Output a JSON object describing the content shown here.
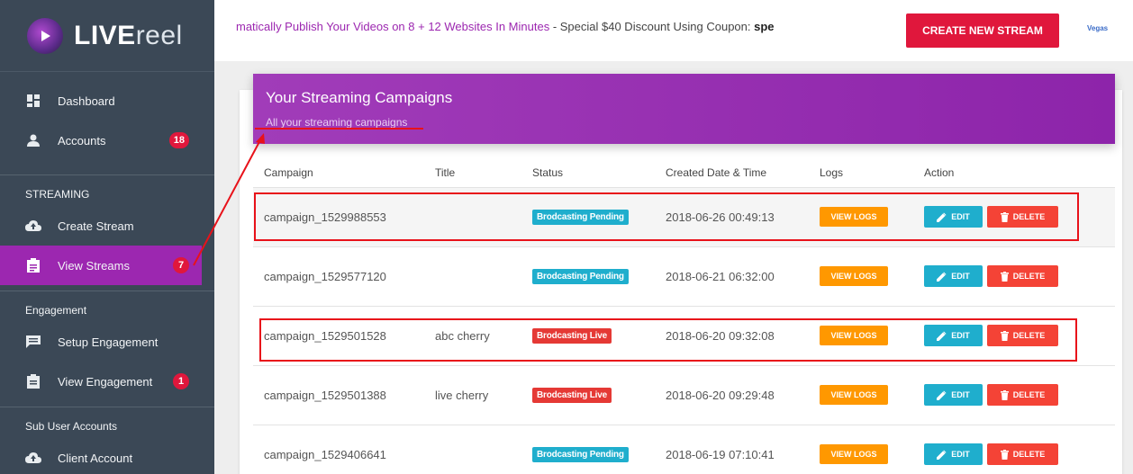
{
  "logo": {
    "bold": "LIVE",
    "light": "reel"
  },
  "sidebar": {
    "items": [
      {
        "label": "Dashboard"
      },
      {
        "label": "Accounts",
        "badge": "18"
      }
    ],
    "sections": [
      {
        "title": "STREAMING",
        "items": [
          {
            "label": "Create Stream"
          },
          {
            "label": "View Streams",
            "badge": "7"
          }
        ]
      },
      {
        "title": "Engagement",
        "items": [
          {
            "label": "Setup Engagement"
          },
          {
            "label": "View Engagement",
            "badge": "1"
          }
        ]
      },
      {
        "title": "Sub User Accounts",
        "items": [
          {
            "label": "Client Account"
          }
        ]
      }
    ]
  },
  "topbar": {
    "marquee_link": "matically Publish Your Videos on 8 + 12 Websites In Minutes",
    "marquee_text": " - Special $40 Discount Using Coupon: ",
    "coupon": "spe",
    "create_label": "CREATE NEW STREAM",
    "partner": "Vegas"
  },
  "card": {
    "title": "Your Streaming Campaigns",
    "subtitle": "All your streaming campaigns"
  },
  "table": {
    "headers": [
      "Campaign",
      "Title",
      "Status",
      "Created Date & Time",
      "Logs",
      "Action"
    ],
    "logs_label": "VIEW LOGS",
    "edit_label": "EDIT",
    "delete_label": "DELETE",
    "rows": [
      {
        "campaign": "campaign_1529988553",
        "title": "",
        "status": "Brodcasting Pending",
        "created": "2018-06-26 00:49:13"
      },
      {
        "campaign": "campaign_1529577120",
        "title": "",
        "status": "Brodcasting Pending",
        "created": "2018-06-21 06:32:00"
      },
      {
        "campaign": "campaign_1529501528",
        "title": "abc cherry",
        "status": "Brodcasting Live",
        "created": "2018-06-20 09:32:08"
      },
      {
        "campaign": "campaign_1529501388",
        "title": "live cherry",
        "status": "Brodcasting Live",
        "created": "2018-06-20 09:29:48"
      },
      {
        "campaign": "campaign_1529406641",
        "title": "",
        "status": "Brodcasting Pending",
        "created": "2018-06-19 07:10:41"
      }
    ]
  },
  "colors": {
    "accent": "#9c27b0",
    "danger": "#e0173c",
    "info": "#1faecd",
    "warning": "#ff9800",
    "sidebar": "#3b4856"
  }
}
